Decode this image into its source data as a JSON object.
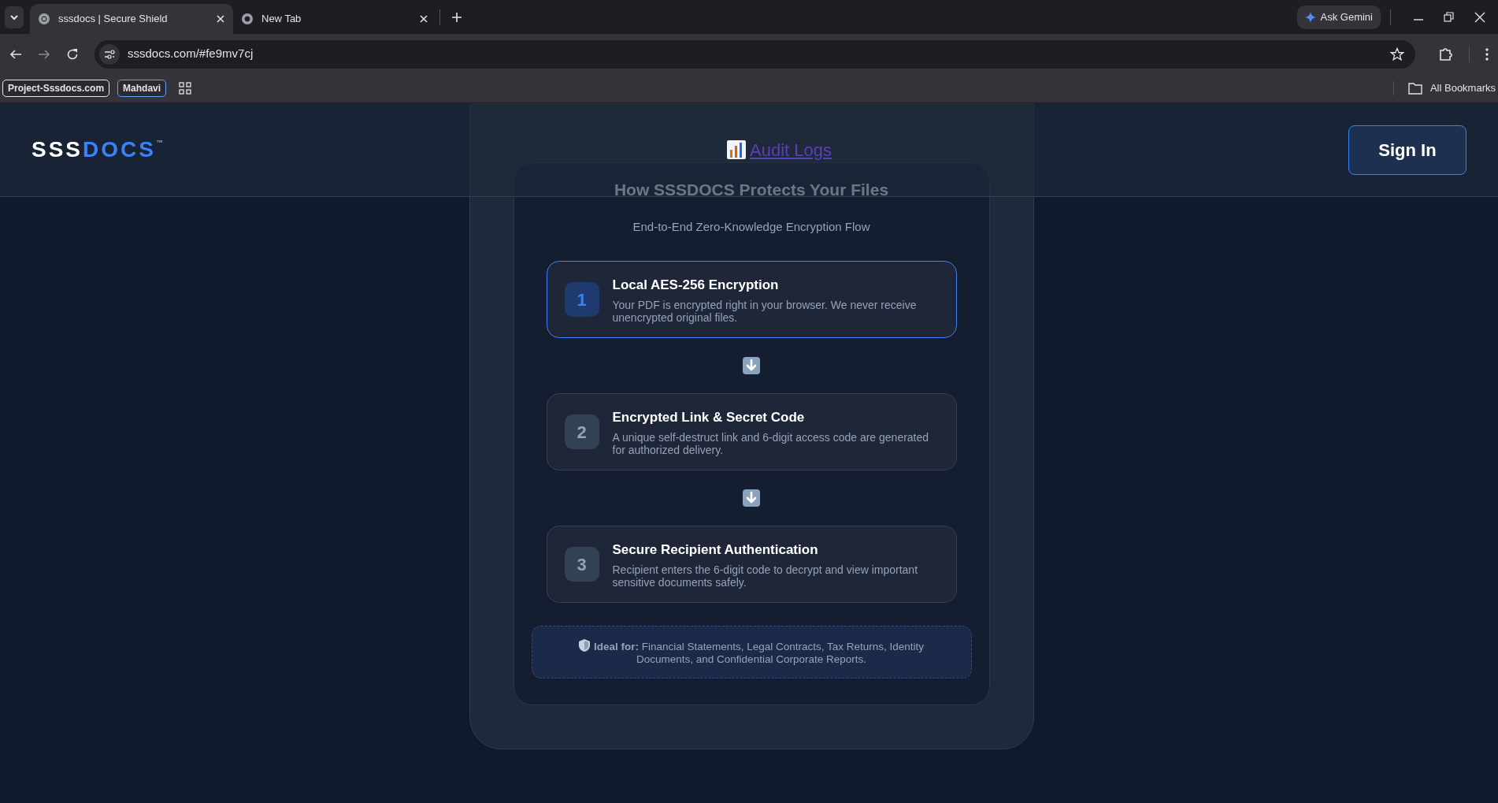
{
  "browser": {
    "tabs": [
      {
        "title": "sssdocs | Secure Shield",
        "selected": true
      },
      {
        "title": "New Tab",
        "selected": false
      }
    ],
    "ask_button": "Ask Gemini",
    "url": "sssdocs.com/#fe9mv7cj",
    "bookmarks": [
      {
        "label": "Project-Sssdocs.com",
        "color": "#e5e7eb"
      },
      {
        "label": "Mahdavi",
        "color": "#60a5fa"
      }
    ],
    "all_bookmarks": "All Bookmarks"
  },
  "header": {
    "logo": {
      "part_1": "SSS",
      "part_2": "DOCS",
      "mark": "™"
    },
    "link": "Audit Logs",
    "sign_in": "Sign In"
  },
  "card": {
    "title": "How SSSDOCS Protects Your Files",
    "subtitle": "End-to-End Zero-Knowledge Encryption Flow",
    "steps": [
      {
        "number": "1",
        "title": "Local AES-256 Encryption",
        "text": "Your PDF is encrypted right in your browser. We never receive unencrypted original files.",
        "selected": true
      },
      {
        "number": "2",
        "title": "Encrypted Link & Secret Code",
        "text": "A unique self-destruct link and 6-digit access code are generated for authorized delivery.",
        "selected": false
      },
      {
        "number": "3",
        "title": "Secure Recipient Authentication",
        "text": "Recipient enters the 6-digit code to decrypt and view important sensitive documents safely.",
        "selected": false
      }
    ],
    "note": "**Ideal for:** Financial Statements, Legal Contracts, Tax Returns, Identity Documents, and Confidential Corporate Reports."
  }
}
